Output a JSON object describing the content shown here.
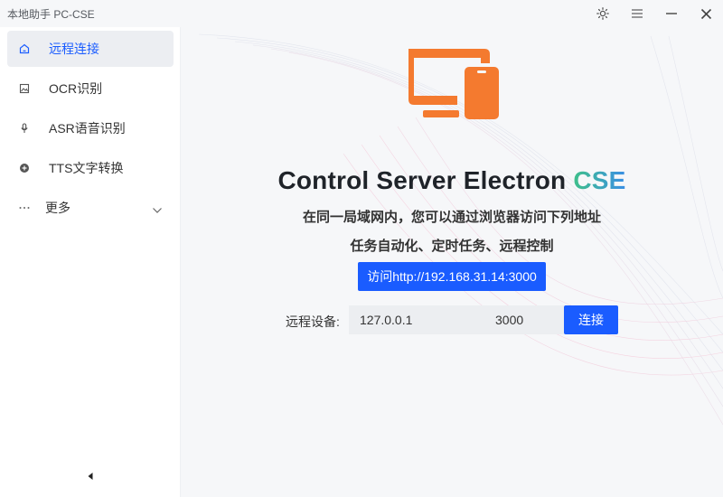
{
  "app": {
    "title": "本地助手 PC-CSE"
  },
  "window_controls": [
    "theme-icon",
    "menu-icon",
    "minimize-icon",
    "close-icon"
  ],
  "sidebar": {
    "items": [
      {
        "label": "远程连接",
        "icon": "home-icon",
        "active": true
      },
      {
        "label": "OCR识别",
        "icon": "image-icon",
        "active": false
      },
      {
        "label": "ASR语音识别",
        "icon": "microphone-icon",
        "active": false
      },
      {
        "label": "TTS文字转换",
        "icon": "tts-icon",
        "active": false
      },
      {
        "label": "更多",
        "icon": "more-icon",
        "active": false
      }
    ],
    "collapse_icon": "collapse-left-icon"
  },
  "main": {
    "hero_icon": "desktop-device-icon",
    "headline": "Control Server Electron",
    "headline_accent": "CSE",
    "subtitle1": "在同一局域网内，您可以通过浏览器访问下列地址",
    "subtitle2": "任务自动化、定时任务、远程控制",
    "visit_button": "访问http://192.168.31.14:3000",
    "remote_label": "远程设备:",
    "ip_value": "127.0.0.1",
    "port_value": "3000",
    "connect_button": "连接"
  },
  "colors": {
    "accent": "#1a5cff",
    "hero_icon": "#f47a2f",
    "cse_gradient_start": "#3fc08a",
    "cse_gradient_end": "#3a8ee6"
  }
}
